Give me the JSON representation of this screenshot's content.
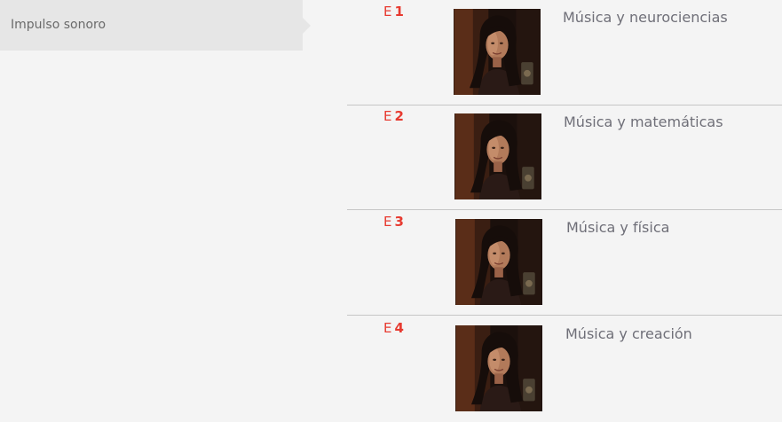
{
  "sidebar": {
    "active_item": {
      "label": "Impulso sonoro"
    }
  },
  "episodes": [
    {
      "prefix": "E",
      "number": "1",
      "title": "Música y neurociencias",
      "thumbnail": "presenter-portrait"
    },
    {
      "prefix": "E",
      "number": "2",
      "title": "Música y matemáticas",
      "thumbnail": "presenter-portrait"
    },
    {
      "prefix": "E",
      "number": "3",
      "title": "Música y física",
      "thumbnail": "presenter-portrait"
    },
    {
      "prefix": "E",
      "number": "4",
      "title": "Música y creación",
      "thumbnail": "presenter-portrait"
    }
  ],
  "colors": {
    "accent": "#e73a30",
    "title_text": "#6f6f78",
    "sidebar_bg": "#e6e6e6",
    "page_bg": "#f4f4f4",
    "divider": "#c6c6c6"
  }
}
